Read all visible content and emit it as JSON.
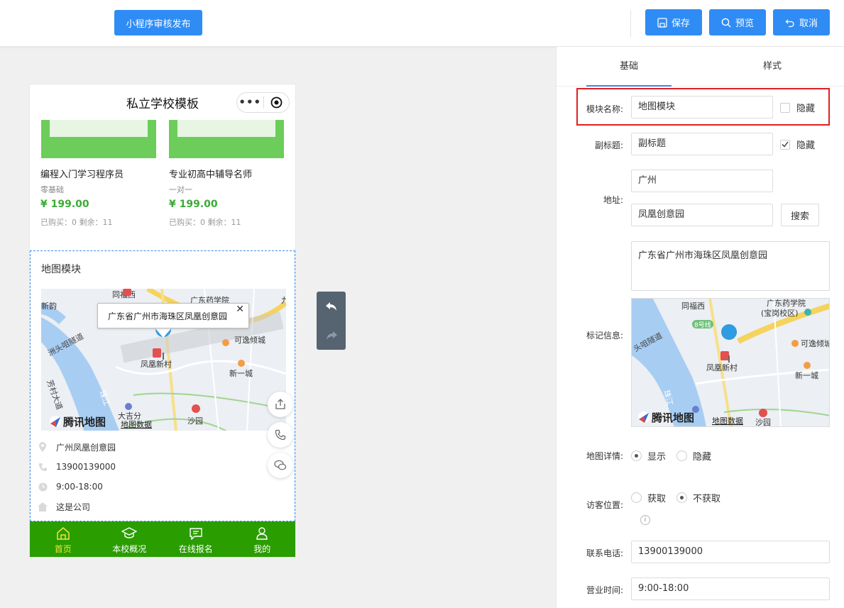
{
  "topbar": {
    "publish_label": "小程序审核发布",
    "save_label": "保存",
    "preview_label": "预览",
    "cancel_label": "取消"
  },
  "phone": {
    "title": "私立学校模板",
    "courses": [
      {
        "name": "编程入门学习程序员",
        "sub": "零基础",
        "price": "¥ 199.00",
        "stat": "已购买：0 剩余：11"
      },
      {
        "name": "专业初高中辅导名师",
        "sub": "一对一",
        "price": "¥ 199.00",
        "stat": "已购买：0 剩余：11"
      }
    ],
    "map_module": {
      "title": "地图模块",
      "popup": "广东省广州市海珠区凤凰创意园",
      "popup_close": "✕",
      "map_labels": {
        "shuangqiao": "新韵",
        "tongfuxi": "同福西",
        "yaoxueyuan": "广东药学院",
        "keyiqingcheng": "可逸倾城",
        "fenghuangxincun": "凤凰新村",
        "xinyicheng": "新一城",
        "zhouxiu": "洲头咀隧道",
        "fangcun": "芳村大道",
        "zhujiang": "珠江",
        "dagang": "大吉分",
        "shayuan": "沙园",
        "brand": "腾讯地图",
        "mapdata": "地图数据",
        "edge": "九"
      },
      "address": "广州凤凰创意园",
      "phone": "13900139000",
      "hours": "9:00-18:00",
      "company": "这是公司"
    },
    "tabbar": [
      {
        "label": "首页",
        "icon": "home-icon",
        "active": true
      },
      {
        "label": "本校概况",
        "icon": "graduation-cap-icon",
        "active": false
      },
      {
        "label": "在线报名",
        "icon": "message-icon",
        "active": false
      },
      {
        "label": "我的",
        "icon": "user-icon",
        "active": false
      }
    ],
    "accent_color": "#2a9d00"
  },
  "panel": {
    "tabs": [
      "基础",
      "样式"
    ],
    "active_tab": "基础",
    "fields": {
      "module_name_label": "模块名称:",
      "module_name_value": "地图模块",
      "hide_label": "隐藏",
      "subtitle_label": "副标题:",
      "subtitle_value": "副标题",
      "subtitle_hide_label": "隐藏",
      "address_label": "地址:",
      "city_value": "广州",
      "keyword_value": "凤凰创意园",
      "search_label": "搜索",
      "full_address": "广东省广州市海珠区凤凰创意园",
      "marker_label": "标记信息:",
      "thumb_labels": {
        "tongfuxi": "同福西",
        "yaoxueyuan": "广东药学院",
        "campus": "(宝岗校区)",
        "line8": "8号线",
        "keyiqingcheng": "可逸倾城",
        "zhouxiu": "头咀隧道",
        "fenghuangxincun": "凤凰新村",
        "xinyicheng": "新一城",
        "zhujiang": "珠江",
        "brand": "腾讯地图",
        "mapdata": "地图数据",
        "shayuan": "沙园"
      },
      "map_detail_label": "地图详情:",
      "show_label": "显示",
      "hide2_label": "隐藏",
      "visitor_label": "访客位置:",
      "get_label": "获取",
      "noget_label": "不获取",
      "info_icon": "i",
      "phone_label": "联系电话:",
      "phone_value": "13900139000",
      "hours_label": "营业时间:",
      "hours_value": "9:00-18:00"
    }
  },
  "colors": {
    "primary": "#2f8cf5",
    "highlight": "#e02020",
    "price": "#3caa37"
  }
}
